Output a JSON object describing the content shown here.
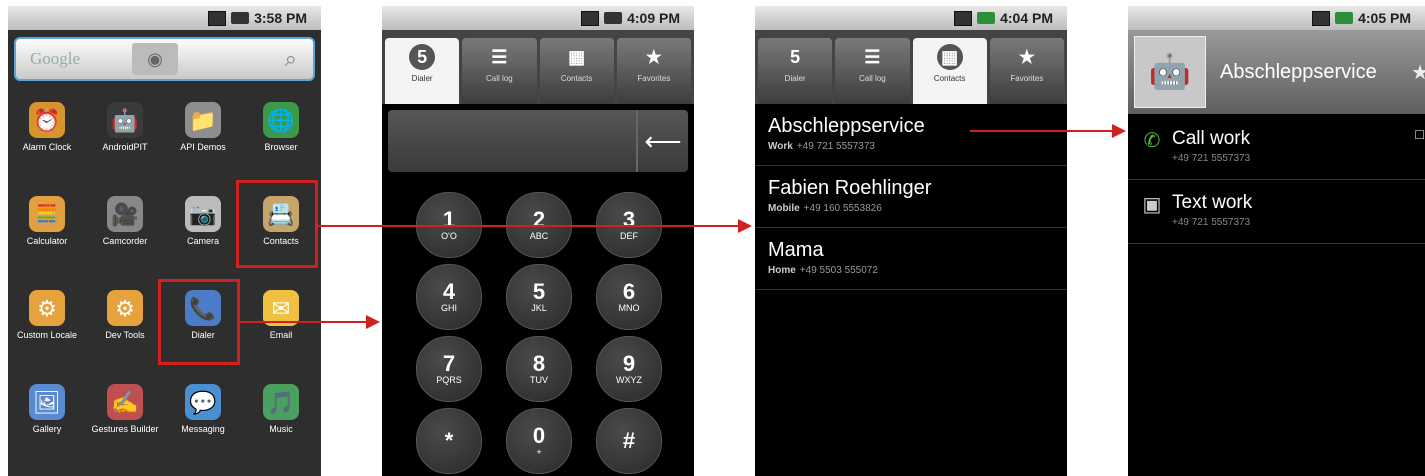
{
  "screens": {
    "launcher": {
      "time": "3:58 PM",
      "search": {
        "logo": "Google"
      },
      "apps": [
        {
          "label": "Alarm Clock",
          "icon": "alarm-clock-icon",
          "glyph": "⏰"
        },
        {
          "label": "AndroidPIT",
          "icon": "androidpit-icon",
          "glyph": "🤖"
        },
        {
          "label": "API Demos",
          "icon": "folder-icon",
          "glyph": "📁"
        },
        {
          "label": "Browser",
          "icon": "globe-icon",
          "glyph": "🌐"
        },
        {
          "label": "Calculator",
          "icon": "calculator-icon",
          "glyph": "🧮"
        },
        {
          "label": "Camcorder",
          "icon": "camcorder-icon",
          "glyph": "🎥"
        },
        {
          "label": "Camera",
          "icon": "camera-icon",
          "glyph": "📷"
        },
        {
          "label": "Contacts",
          "icon": "contacts-icon",
          "glyph": "📇"
        },
        {
          "label": "Custom Locale",
          "icon": "gear-icon",
          "glyph": "⚙"
        },
        {
          "label": "Dev Tools",
          "icon": "gear-icon",
          "glyph": "⚙"
        },
        {
          "label": "Dialer",
          "icon": "phone-icon",
          "glyph": "📞"
        },
        {
          "label": "Email",
          "icon": "email-icon",
          "glyph": "✉"
        },
        {
          "label": "Gallery",
          "icon": "gallery-icon",
          "glyph": "🖼"
        },
        {
          "label": "Gestures Builder",
          "icon": "gestures-icon",
          "glyph": "✍"
        },
        {
          "label": "Messaging",
          "icon": "messaging-icon",
          "glyph": "💬"
        },
        {
          "label": "Music",
          "icon": "music-icon",
          "glyph": "🎵"
        }
      ]
    },
    "dialer": {
      "time": "4:09 PM",
      "tabs": [
        {
          "label": "Dialer",
          "glyph": "5",
          "active": true
        },
        {
          "label": "Call log",
          "glyph": "☰",
          "active": false
        },
        {
          "label": "Contacts",
          "glyph": "▦",
          "active": false
        },
        {
          "label": "Favorites",
          "glyph": "★",
          "active": false
        }
      ],
      "keys": [
        {
          "num": "1",
          "letters": "O'O"
        },
        {
          "num": "2",
          "letters": "ABC"
        },
        {
          "num": "3",
          "letters": "DEF"
        },
        {
          "num": "4",
          "letters": "GHI"
        },
        {
          "num": "5",
          "letters": "JKL"
        },
        {
          "num": "6",
          "letters": "MNO"
        },
        {
          "num": "7",
          "letters": "PQRS"
        },
        {
          "num": "8",
          "letters": "TUV"
        },
        {
          "num": "9",
          "letters": "WXYZ"
        },
        {
          "num": "*",
          "letters": ""
        },
        {
          "num": "0",
          "letters": "+"
        },
        {
          "num": "#",
          "letters": ""
        }
      ]
    },
    "contacts": {
      "time": "4:04 PM",
      "tabs": [
        {
          "label": "Dialer",
          "glyph": "5",
          "active": false
        },
        {
          "label": "Call log",
          "glyph": "☰",
          "active": false
        },
        {
          "label": "Contacts",
          "glyph": "▦",
          "active": true
        },
        {
          "label": "Favorites",
          "glyph": "★",
          "active": false
        }
      ],
      "list": [
        {
          "name": "Abschleppservice",
          "type": "Work",
          "number": "+49 721 5557373"
        },
        {
          "name": "Fabien Roehlinger",
          "type": "Mobile",
          "number": "+49 160 5553826"
        },
        {
          "name": "Mama",
          "type": "Home",
          "number": "+49 5503 555072"
        }
      ]
    },
    "detail": {
      "time": "4:05 PM",
      "name": "Abschleppservice",
      "actions": [
        {
          "title": "Call work",
          "number": "+49 721 5557373",
          "icon": "phone-icon"
        },
        {
          "title": "Text work",
          "number": "+49 721 5557373",
          "icon": "sms-icon"
        }
      ]
    }
  },
  "colors": {
    "highlight": "#d12020"
  }
}
